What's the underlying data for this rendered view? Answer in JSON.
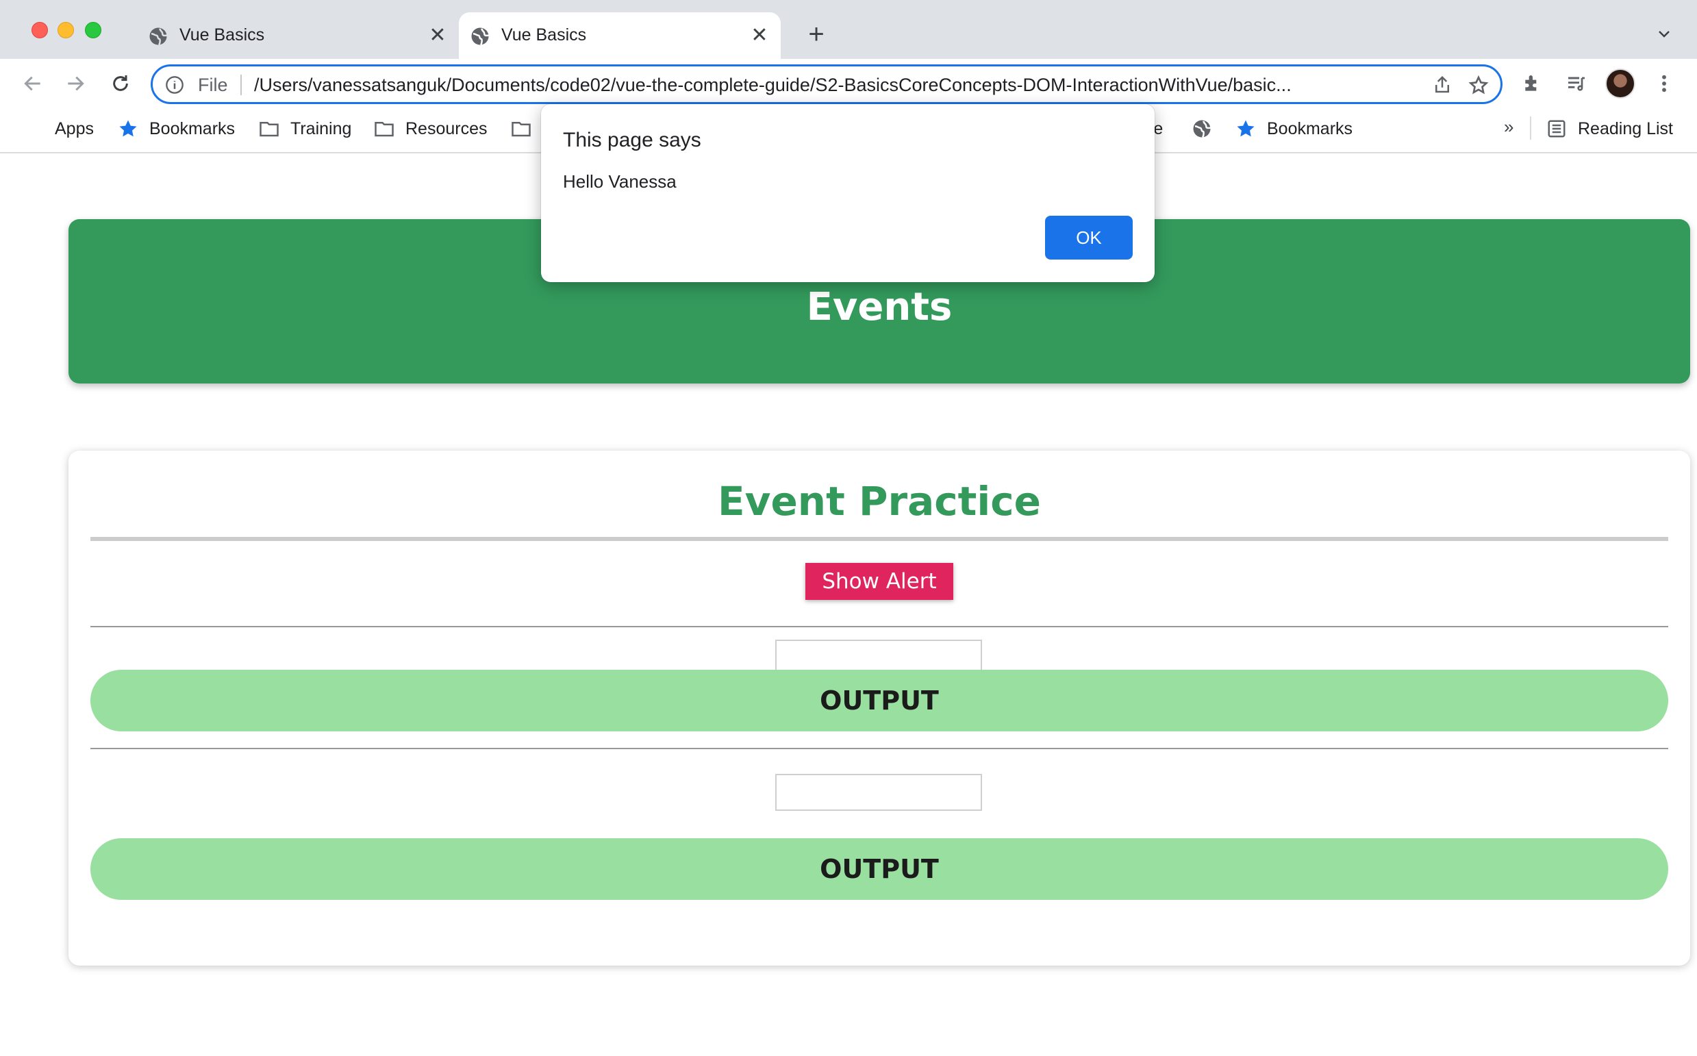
{
  "browser": {
    "tabs": [
      {
        "title": "Vue Basics",
        "active": false
      },
      {
        "title": "Vue Basics",
        "active": true
      }
    ],
    "omnibox": {
      "scheme_label": "File",
      "url": "/Users/vanessatsanguk/Documents/code02/vue-the-complete-guide/S2-BasicsCoreConcepts-DOM-InteractionWithVue/basic..."
    },
    "bookmarks": [
      {
        "label": "Apps",
        "icon": "apps-grid-icon"
      },
      {
        "label": "Bookmarks",
        "icon": "star-icon"
      },
      {
        "label": "Training",
        "icon": "folder-icon"
      },
      {
        "label": "Resources",
        "icon": "folder-icon"
      },
      {
        "label": "re",
        "icon": "folder-icon"
      },
      {
        "label": "",
        "icon": "globe-icon"
      },
      {
        "label": "Bookmarks",
        "icon": "star-icon"
      }
    ],
    "bookmarks_overflow": "»",
    "reading_list": "Reading List"
  },
  "page": {
    "header_title": "Events",
    "section_title": "Event Practice",
    "show_alert_label": "Show Alert",
    "output_1": "OUTPUT",
    "output_2": "OUTPUT"
  },
  "dialog": {
    "title": "This page says",
    "message": "Hello Vanessa",
    "ok_label": "OK"
  },
  "colors": {
    "header_green": "#339a5c",
    "alert_button": "#e0245e",
    "output_bg": "#98dfa0",
    "chrome_blue": "#1a73e8"
  }
}
